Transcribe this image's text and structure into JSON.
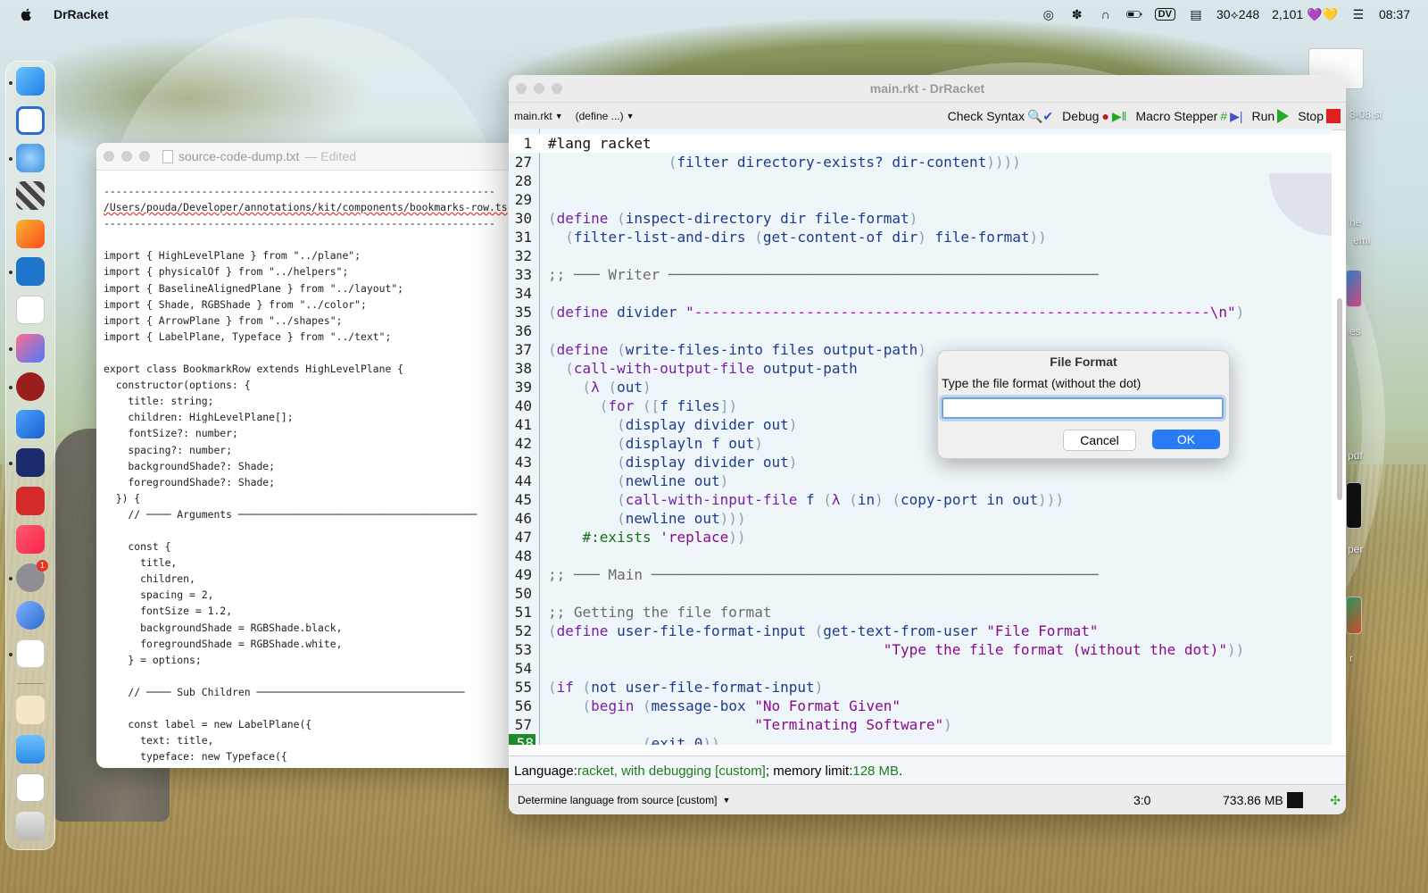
{
  "menubar": {
    "app_name": "DrRacket",
    "status_text": "30⟡248",
    "counter": "2,101",
    "hearts": "💜💛",
    "dv_label": "DV",
    "time": "08:37"
  },
  "desktop": {
    "file_label_1": "3-08.st",
    "file_label_2": "he",
    "file_label_3": "eml",
    "file_label_4": "es",
    "file_label_5": "pdf",
    "file_label_6": "per",
    "file_label_7": "r"
  },
  "dock": {
    "settings_badge": "1"
  },
  "text_window": {
    "title": "source-code-dump.txt",
    "edited": "Edited",
    "separator": "----------------------------------------------------------------",
    "path": "/Users/pouda/Developer/annotations/kit/components/bookmarks-row.ts",
    "lines": [
      "import { HighLevelPlane } from \"../plane\";",
      "import { physicalOf } from \"../helpers\";",
      "import { BaselineAlignedPlane } from \"../layout\";",
      "import { Shade, RGBShade } from \"../color\";",
      "import { ArrowPlane } from \"../shapes\";",
      "import { LabelPlane, Typeface } from \"../text\";",
      "",
      "export class BookmarkRow extends HighLevelPlane {",
      "  constructor(options: {",
      "    title: string;",
      "    children: HighLevelPlane[];",
      "    fontSize?: number;",
      "    spacing?: number;",
      "    backgroundShade?: Shade;",
      "    foregroundShade?: Shade;",
      "  }) {",
      "    // ──── Arguments ───────────────────────────────────────",
      "",
      "    const {",
      "      title,",
      "      children,",
      "      spacing = 2,",
      "      fontSize = 1.2,",
      "      backgroundShade = RGBShade.black,",
      "      foregroundShade = RGBShade.white,",
      "    } = options;",
      "",
      "    // ──── Sub Children ──────────────────────────────────",
      "",
      "    const label = new LabelPlane({",
      "      text: title,",
      "      typeface: new Typeface({"
    ]
  },
  "drracket": {
    "window_title": "main.rkt - DrRacket",
    "file_menu": "main.rkt",
    "define_menu": "(define ...)",
    "check_syntax": "Check Syntax",
    "debug": "Debug",
    "macro_stepper": "Macro Stepper",
    "run": "Run",
    "stop": "Stop",
    "language_prefix": "Language: ",
    "language_value": "racket, with debugging [custom]",
    "memory_prefix": "; memory limit: ",
    "memory_value": "128 MB",
    "memory_suffix": ".",
    "language_selector": "Determine language from source [custom]",
    "cursor_pos": "3:0",
    "mem_usage": "733.86 MB"
  },
  "dialog": {
    "title": "File Format",
    "prompt": "Type the file format (without the dot)",
    "input_value": "",
    "cancel": "Cancel",
    "ok": "OK"
  },
  "colors": {
    "accent_blue": "#2a7cf6",
    "keyword_purple": "#7a1fa2",
    "string_magenta": "#8b0a8b",
    "status_green": "#1f7a1f",
    "stop_red": "#e02020"
  }
}
